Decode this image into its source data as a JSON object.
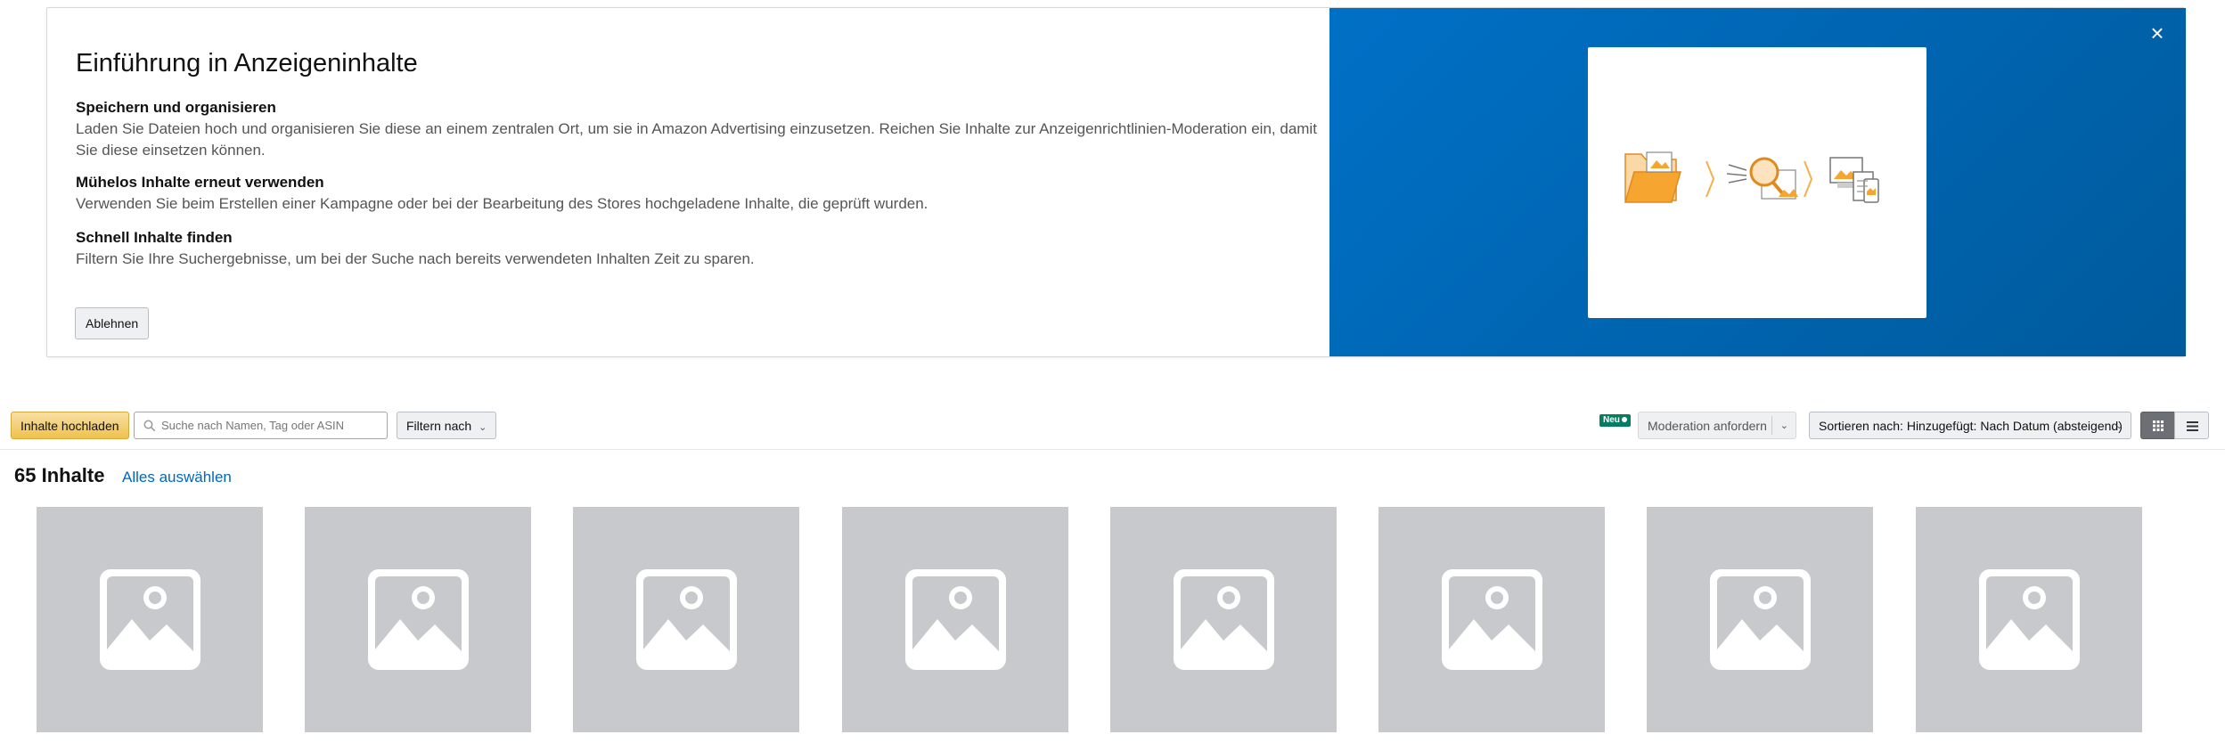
{
  "intro": {
    "title": "Einführung in Anzeigeninhalte",
    "features": [
      {
        "heading": "Speichern und organisieren",
        "text": "Laden Sie Dateien hoch und organisieren Sie diese an einem zentralen Ort, um sie in Amazon Advertising einzusetzen. Reichen Sie Inhalte zur Anzeigenrichtlinien-Moderation ein, damit Sie diese einsetzen können."
      },
      {
        "heading": "Mühelos Inhalte erneut verwenden",
        "text": "Verwenden Sie beim Erstellen einer Kampagne oder bei der Bearbeitung des Stores hochgeladene Inhalte, die geprüft wurden."
      },
      {
        "heading": "Schnell Inhalte finden",
        "text": "Filtern Sie Ihre Suchergebnisse, um bei der Suche nach bereits verwendeten Inhalten Zeit zu sparen."
      }
    ],
    "decline_label": "Ablehnen",
    "close_icon": "×",
    "banner_color": "#0070c6"
  },
  "toolbar": {
    "upload_label": "Inhalte hochladen",
    "search_placeholder": "Suche nach Namen, Tag oder ASIN",
    "filter_label": "Filtern nach",
    "new_badge": "Neu",
    "moderation_label": "Moderation anfordern",
    "sort_label": "Sortieren nach: Hinzugefügt: Nach Datum (absteigend)",
    "upload_color": "#f0c14b"
  },
  "content": {
    "count_label": "65 Inhalte",
    "select_all_label": "Alles auswählen",
    "tiles": [
      {
        "icon": "image-placeholder-icon"
      },
      {
        "icon": "image-placeholder-icon"
      },
      {
        "icon": "image-placeholder-icon"
      },
      {
        "icon": "image-placeholder-icon"
      },
      {
        "icon": "image-placeholder-icon"
      },
      {
        "icon": "image-placeholder-icon"
      },
      {
        "icon": "image-placeholder-icon"
      },
      {
        "icon": "image-placeholder-icon"
      }
    ]
  }
}
